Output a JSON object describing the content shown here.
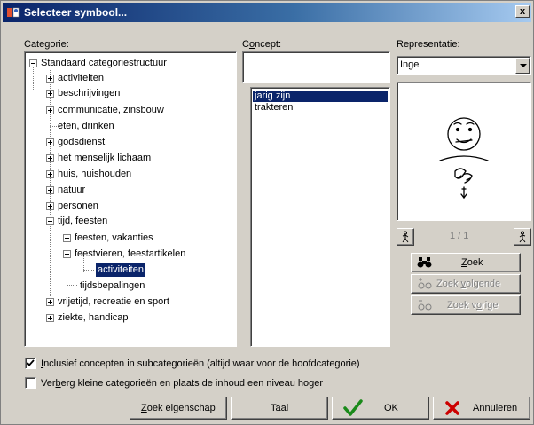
{
  "window": {
    "title": "Selecteer symbool...",
    "close": "x"
  },
  "categorie": {
    "label": "Categorie:",
    "root": "Standaard categoriestructuur",
    "items": [
      "activiteiten",
      "beschrijvingen",
      "communicatie, zinsbouw",
      "eten, drinken",
      "godsdienst",
      "het menselijk lichaam",
      "huis, huishouden",
      "natuur",
      "personen",
      "tijd, feesten",
      "feesten, vakanties",
      "feestvieren, feestartikelen",
      "activiteiten",
      "tijdsbepalingen",
      "vrijetijd, recreatie en sport",
      "ziekte, handicap"
    ]
  },
  "concept": {
    "label_pre": "C",
    "label_u": "o",
    "label_post": "ncept:",
    "search_value": "",
    "items": [
      "jarig zijn",
      "trakteren"
    ]
  },
  "representatie": {
    "label": "Representatie:",
    "selected": "Inge",
    "page_indicator": "1 / 1"
  },
  "buttons": {
    "zoek_u": "Z",
    "zoek_rest": "oek",
    "zoek_volgende_pre": "Zoek ",
    "zoek_volgende_u": "v",
    "zoek_volgende_post": "olgende",
    "zoek_vorige_pre": "Zoek v",
    "zoek_vorige_u": "o",
    "zoek_vorige_post": "rige",
    "zoek_eigenschap_u": "Z",
    "zoek_eigenschap_rest": "oek eigenschap",
    "taal": "Taal",
    "ok": "OK",
    "annuleren": "Annuleren"
  },
  "options": {
    "inclusief_u": "I",
    "inclusief_rest": "nclusief concepten in subcategorieën (altijd waar voor de hoofdcategorie)",
    "inclusief_checked": true,
    "verberg_pre": "Ver",
    "verberg_u": "b",
    "verberg_post": "erg kleine categorieën en plaats de inhoud een niveau hoger",
    "verberg_checked": false
  },
  "colors": {
    "selection": "#0a246a",
    "face": "#d4d0c8",
    "ok_check": "#1a8a1a",
    "cancel_x": "#cc0000"
  }
}
